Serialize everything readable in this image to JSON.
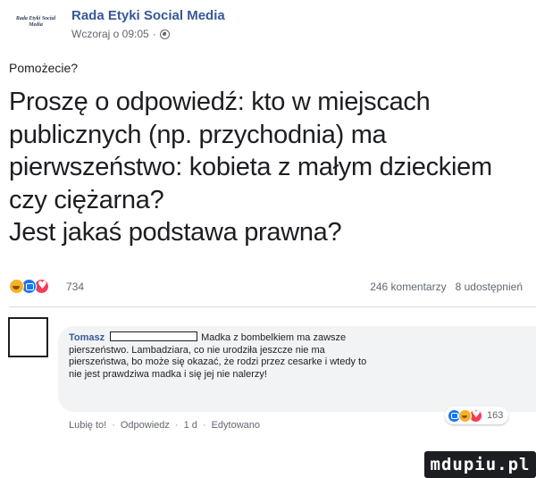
{
  "post": {
    "page_logo_text": "Rada Etyki Social Media",
    "page_name": "Rada Etyki Social Media",
    "timestamp": "Wczoraj o 09:05",
    "meta_separator": "·",
    "question": "Pomożecie?",
    "body_lines": [
      "Proszę o odpowiedź: kto w miejscach",
      "publicznych (np. przychodnia) ma",
      "pierwszeństwo: kobieta z małym dzieckiem",
      "czy ciężarna?",
      "Jest jakaś podstawa prawna?"
    ],
    "reaction_count": "734",
    "comments_count": "246 komentarzy",
    "shares_count": "8 udostępnień"
  },
  "comment": {
    "author": "Tomasz",
    "lines": [
      "Madka z bombelkiem ma zawsze",
      "pierszeństwo. Lambadziara, co nie urodziła jeszcze nie ma",
      "pierszeństwa, bo może się okazać, że rodzi przez cesarke i wtedy to",
      "nie jest prawdziwa madka i się jej nie nalerzy!"
    ],
    "reaction_count": "163",
    "actions": {
      "like": "Lubię to!",
      "reply": "Odpowiedz",
      "time": "1 d",
      "edited": "Edytowano",
      "separator": "·"
    }
  },
  "watermark": "mdupiu.pl",
  "icons": {
    "visibility": "globe-icon",
    "reactions": [
      "haha-reaction-icon",
      "like-reaction-icon",
      "love-reaction-icon"
    ]
  },
  "colors": {
    "link": "#385898",
    "like": "#1877f2",
    "love": "#f33e58",
    "haha": "#f7b125",
    "bubble": "#f2f3f5"
  }
}
